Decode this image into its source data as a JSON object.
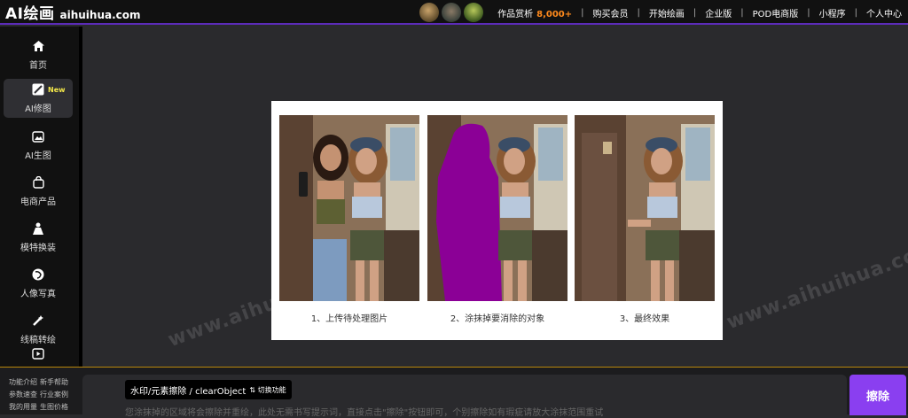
{
  "brand": {
    "name_cn": "AI绘画",
    "domain": "aihuihua.com"
  },
  "nav": {
    "gallery_label": "作品赏析",
    "gallery_count": "8,000+",
    "items": [
      "购买会员",
      "开始绘画",
      "企业版",
      "POD电商版",
      "小程序",
      "个人中心"
    ],
    "separator": "|"
  },
  "sidebar": {
    "items": [
      {
        "label": "首页",
        "icon": "home-icon"
      },
      {
        "label": "AI修图",
        "icon": "edit-image-icon",
        "badge": "New",
        "active": true
      },
      {
        "label": "AI生图",
        "icon": "image-generate-icon"
      },
      {
        "label": "电商产品",
        "icon": "shopping-bag-icon"
      },
      {
        "label": "模特换装",
        "icon": "model-dress-icon"
      },
      {
        "label": "人像写真",
        "icon": "portrait-icon"
      },
      {
        "label": "线稿转绘",
        "icon": "sketch-icon"
      },
      {
        "label": "",
        "icon": "video-icon"
      }
    ]
  },
  "demo": {
    "steps": [
      {
        "caption": "1、上传待处理图片"
      },
      {
        "caption": "2、涂抹掉要消除的对象"
      },
      {
        "caption": "3、最终效果"
      }
    ]
  },
  "watermark_text": "www.aihuihua.com",
  "bottom": {
    "links_row1": [
      "功能介绍",
      "新手帮助"
    ],
    "links_row2": [
      "参数速查",
      "行业案例"
    ],
    "links_row3": [
      "我的用量",
      "生图价格"
    ],
    "mode_label": "水印/元素擦除 / clearObject",
    "mode_toggle": "⇅ 切换功能",
    "prompt_hint": "您涂抹掉的区域将会擦除并重绘，此处无需书写提示词，直接点击\"擦除\"按钮即可，个别擦除如有瑕疵请放大涂抹范围重试",
    "erase_label": "擦除"
  },
  "colors": {
    "accent": "#8a3ff0",
    "count": "#ff8a1c",
    "badge": "#f5e94a",
    "mask": "#8b0096"
  }
}
